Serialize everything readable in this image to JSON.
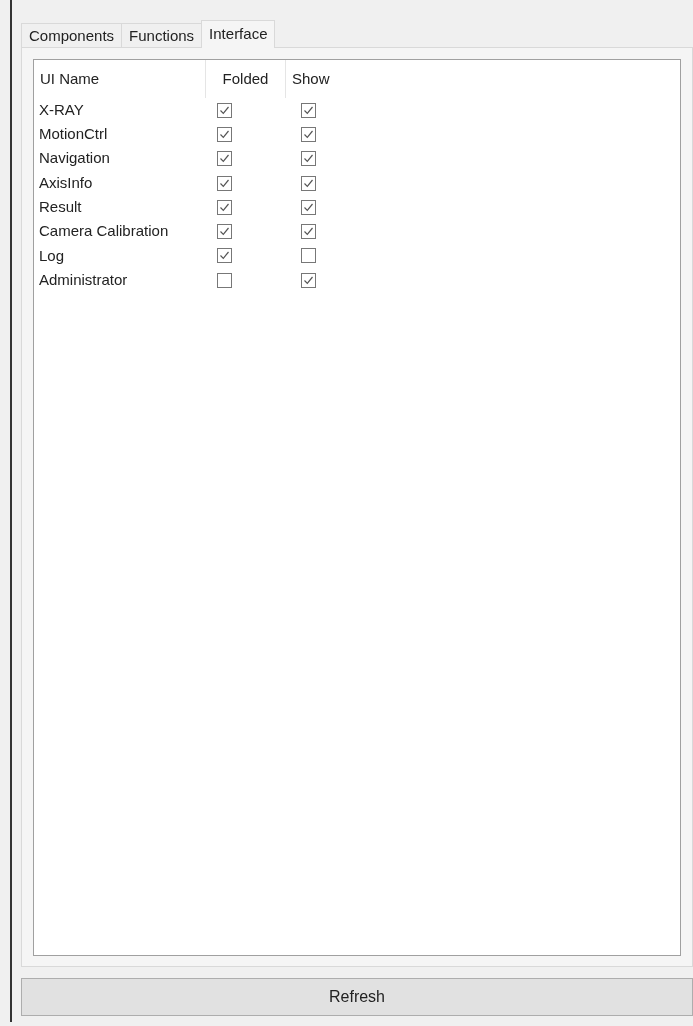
{
  "tabs": [
    {
      "label": "Components",
      "selected": false
    },
    {
      "label": "Functions",
      "selected": false
    },
    {
      "label": "Interface",
      "selected": true
    }
  ],
  "table": {
    "columns": [
      "UI Name",
      "Folded",
      "Show"
    ],
    "rows": [
      {
        "name": "X-RAY",
        "folded": true,
        "show": true
      },
      {
        "name": "MotionCtrl",
        "folded": true,
        "show": true
      },
      {
        "name": "Navigation",
        "folded": true,
        "show": true
      },
      {
        "name": "AxisInfo",
        "folded": true,
        "show": true
      },
      {
        "name": "Result",
        "folded": true,
        "show": true
      },
      {
        "name": "Camera Calibration",
        "folded": true,
        "show": true
      },
      {
        "name": "Log",
        "folded": true,
        "show": false
      },
      {
        "name": "Administrator",
        "folded": false,
        "show": true
      }
    ]
  },
  "buttons": [
    "Refresh"
  ]
}
